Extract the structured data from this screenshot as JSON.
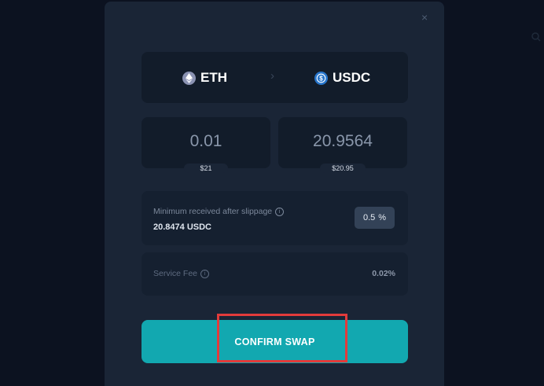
{
  "modal": {
    "close_glyph": "×"
  },
  "pair": {
    "from_token": "ETH",
    "to_token": "USDC",
    "arrow_glyph": "›"
  },
  "amounts": {
    "from_amount": "0.01",
    "from_usd": "$21",
    "to_amount": "20.9564",
    "to_usd": "$20.95"
  },
  "slippage": {
    "label": "Minimum received after slippage",
    "min_received": "20.8474 USDC",
    "percent_value": "0.5",
    "percent_sign": "%"
  },
  "fee": {
    "label": "Service Fee",
    "value": "0.02%"
  },
  "confirm": {
    "label": "CONFIRM SWAP"
  },
  "colors": {
    "accent": "#12a8b0",
    "highlight": "#e23b3b",
    "eth": "#8a92b2",
    "usdc": "#2775ca"
  },
  "icons": [
    "close-icon",
    "eth-icon",
    "usdc-icon",
    "chevron-right-icon",
    "info-icon"
  ]
}
